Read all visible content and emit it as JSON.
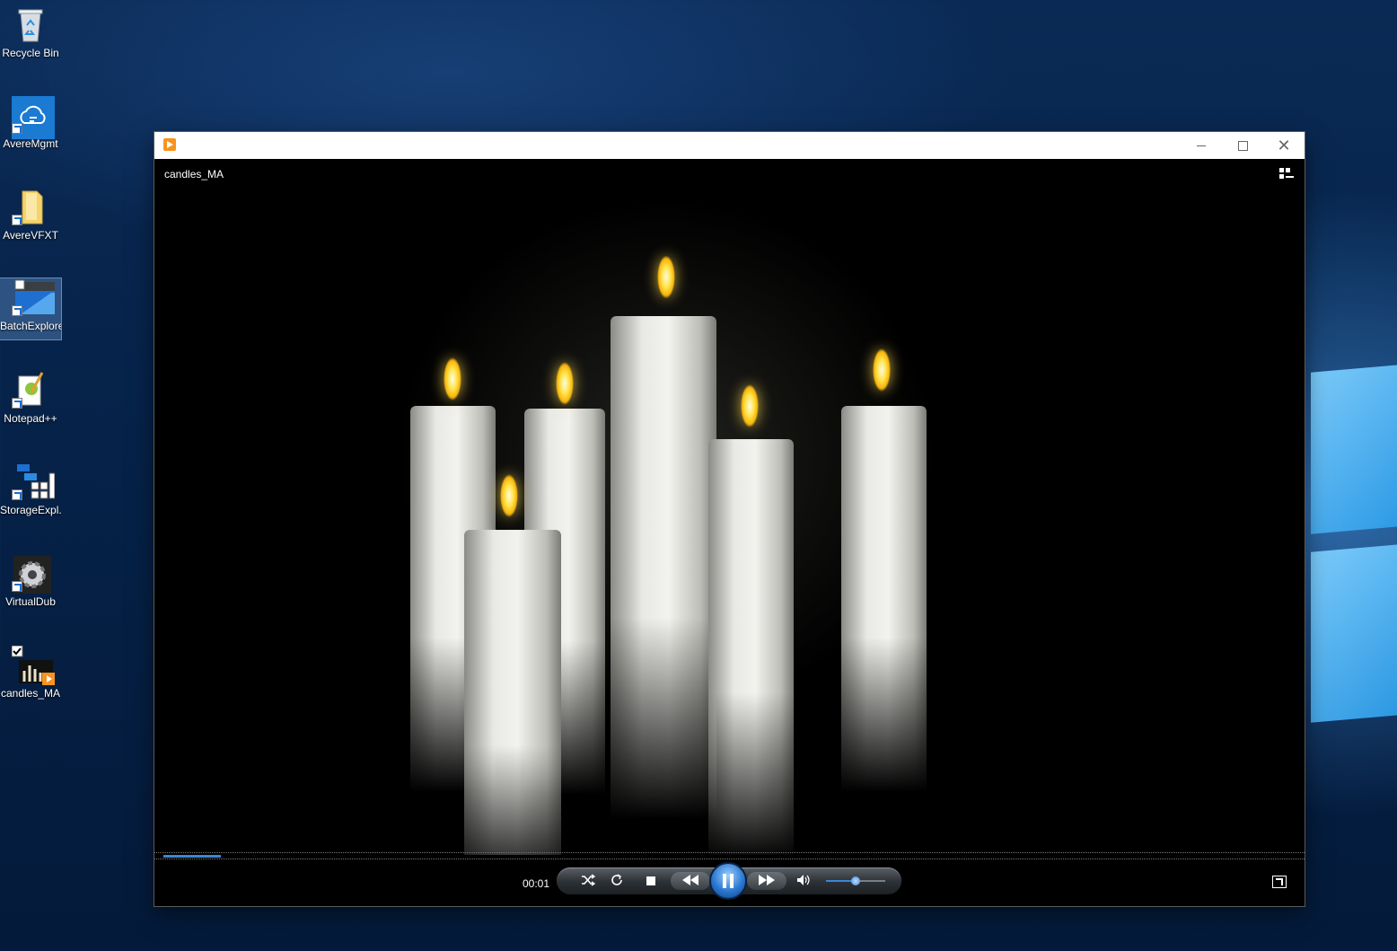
{
  "desktop": {
    "icons": [
      {
        "label": "Recycle Bin"
      },
      {
        "label": "AvereMgmt"
      },
      {
        "label": "AvereVFXT"
      },
      {
        "label": "BatchExplorer"
      },
      {
        "label": "Notepad++"
      },
      {
        "label": "StorageExpl..."
      },
      {
        "label": "VirtualDub"
      },
      {
        "label": "candles_MA"
      }
    ]
  },
  "player": {
    "window_controls": {
      "minimize": "—",
      "maximize": "☐",
      "close": "✕"
    },
    "media_title": "candles_MA",
    "time": "00:01",
    "playback_progress": 0.05,
    "volume_level": 0.5,
    "state": "playing",
    "accent_color": "#3a86d6"
  }
}
